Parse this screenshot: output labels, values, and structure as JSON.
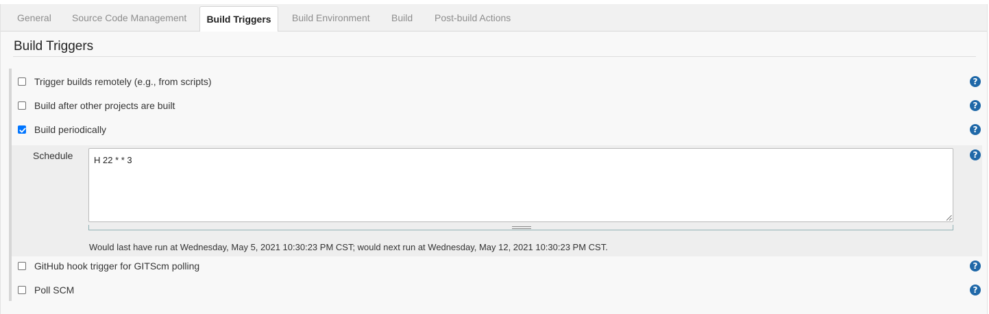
{
  "tabs": [
    {
      "label": "General",
      "active": false
    },
    {
      "label": "Source Code Management",
      "active": false
    },
    {
      "label": "Build Triggers",
      "active": true
    },
    {
      "label": "Build Environment",
      "active": false
    },
    {
      "label": "Build",
      "active": false
    },
    {
      "label": "Post-build Actions",
      "active": false
    }
  ],
  "section": {
    "title": "Build Triggers"
  },
  "triggers": [
    {
      "label": "Trigger builds remotely (e.g., from scripts)",
      "checked": false
    },
    {
      "label": "Build after other projects are built",
      "checked": false
    },
    {
      "label": "Build periodically",
      "checked": true
    },
    {
      "label": "GitHub hook trigger for GITScm polling",
      "checked": false
    },
    {
      "label": "Poll SCM",
      "checked": false
    }
  ],
  "schedule": {
    "label": "Schedule",
    "value": "H 22 * * 3",
    "note": "Would last have run at Wednesday, May 5, 2021 10:30:23 PM CST; would next run at Wednesday, May 12, 2021 10:30:23 PM CST."
  },
  "help": {
    "glyph": "?",
    "color": "#1f68a8"
  },
  "colors": {
    "checkbox_checked": "#0075ff",
    "active_tab_text": "#222222",
    "inactive_tab_text": "#8d8d8d"
  }
}
